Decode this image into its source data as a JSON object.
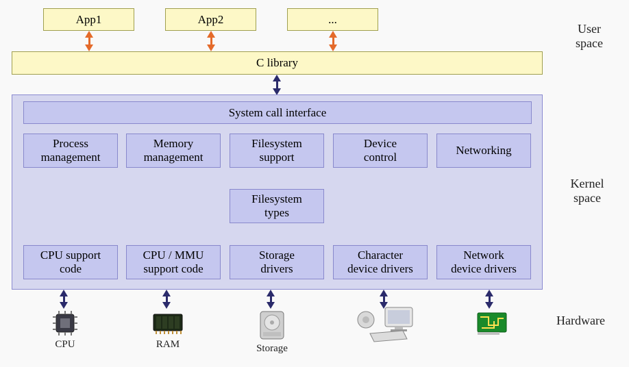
{
  "user_space": {
    "label": "User\nspace",
    "apps": [
      "App1",
      "App2",
      "..."
    ],
    "c_library": "C library"
  },
  "kernel_space": {
    "label": "Kernel\nspace",
    "syscall": "System call interface",
    "row1": [
      "Process\nmanagement",
      "Memory\nmanagement",
      "Filesystem\nsupport",
      "Device\ncontrol",
      "Networking"
    ],
    "fs_types": "Filesystem\ntypes",
    "row2": [
      "CPU support\ncode",
      "CPU / MMU\nsupport code",
      "Storage\ndrivers",
      "Character\ndevice drivers",
      "Network\ndevice drivers"
    ]
  },
  "hardware": {
    "label": "Hardware",
    "items": [
      "CPU",
      "RAM",
      "Storage",
      "",
      ""
    ]
  }
}
